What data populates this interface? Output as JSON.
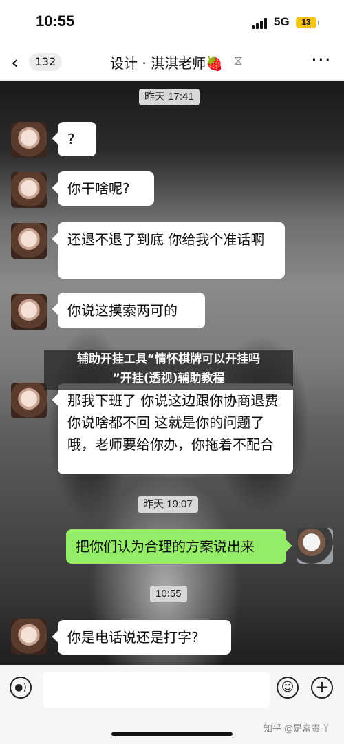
{
  "status_bar": {
    "time": "10:55",
    "network": "5G",
    "battery": "13"
  },
  "header": {
    "back_count": "132",
    "title": "设计 · 淇淇老师🍓"
  },
  "timestamps": [
    "昨天 17:41",
    "昨天 19:07",
    "10:55"
  ],
  "messages": [
    {
      "sender": "other",
      "text": "?"
    },
    {
      "sender": "other",
      "text": "你干啥呢?"
    },
    {
      "sender": "other",
      "text": "还退不退了到底  你给我个准话啊"
    },
    {
      "sender": "other",
      "text": "你说这摸索两可的"
    },
    {
      "sender": "other",
      "text": "那我下班了  你说这边跟你协商退费  你说啥都不回  这就是你的问题了哦，老师要给你办，你拖着不配合"
    },
    {
      "sender": "self",
      "text": "把你们认为合理的方案说出来"
    },
    {
      "sender": "other",
      "text": "你是电话说还是打字?"
    }
  ],
  "overlay": {
    "line1": "辅助开挂工具“情怀棋牌可以开挂吗",
    "line2": "”开挂(透视)辅助教程"
  },
  "input_bar": {
    "voice_icon": "voice-icon",
    "emoji_icon": "emoji-icon",
    "plus_icon": "plus-icon"
  },
  "watermark": "知乎 @是富贵吖",
  "colors": {
    "self_bubble": "#95ec69",
    "other_bubble": "#ffffff",
    "battery": "#f3c614"
  }
}
